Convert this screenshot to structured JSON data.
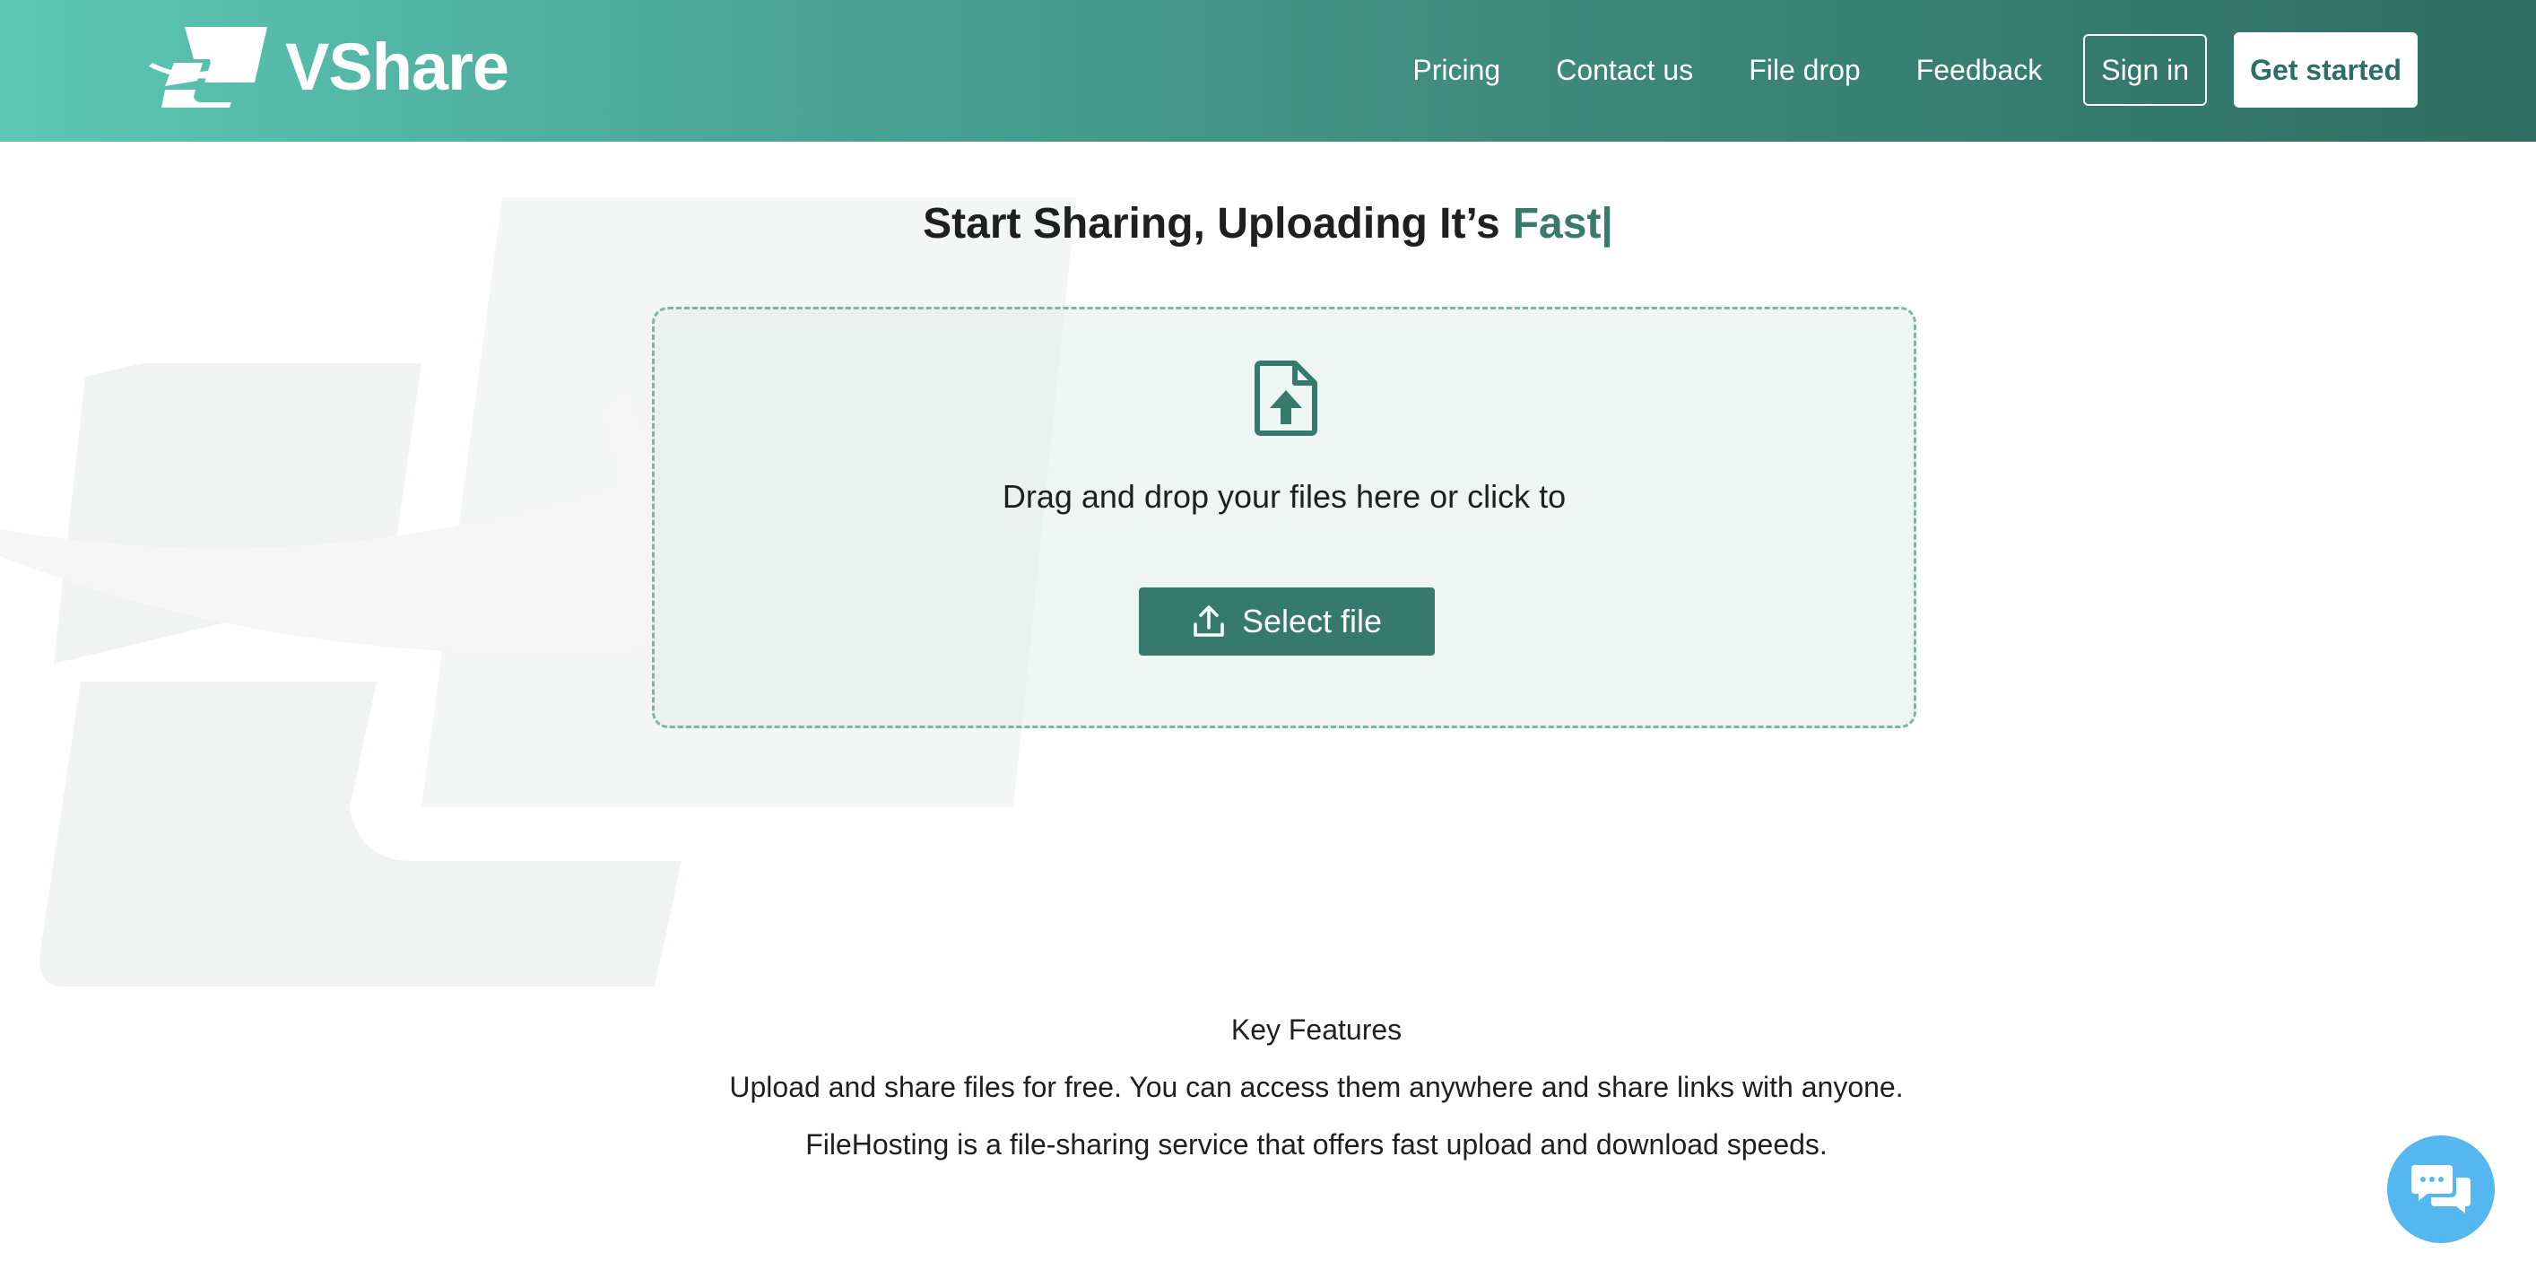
{
  "header": {
    "brand": "VShare",
    "nav": {
      "pricing": "Pricing",
      "contact": "Contact us",
      "file_drop": "File drop",
      "feedback": "Feedback"
    },
    "sign_in": "Sign in",
    "get_started": "Get started"
  },
  "hero": {
    "headline": "Start Sharing, Uploading It’s",
    "typed_word": "Fast|"
  },
  "upload": {
    "drop_text": "Drag and drop your files here or click to",
    "select_button": "Select file",
    "icon": "file-upload-icon",
    "button_icon": "upload-icon"
  },
  "features": {
    "title": "Key Features",
    "line1": "Upload and share files for free. You can access them anywhere and share links with anyone.",
    "line2": "FileHosting is a file-sharing service that offers fast upload and download speeds."
  },
  "chat": {
    "icon": "chat-icon"
  },
  "colors": {
    "header_start": "#5cc7b5",
    "header_end": "#2f6e63",
    "accent": "#3a7a6c",
    "button": "#357a6d",
    "chat": "#55b7ef"
  }
}
